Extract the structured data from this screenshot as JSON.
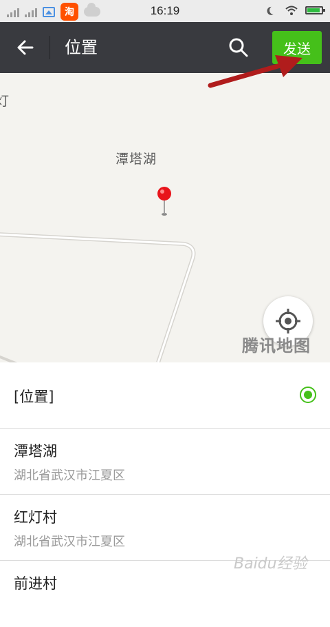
{
  "status_bar": {
    "time": "16:19"
  },
  "title_bar": {
    "title": "位置",
    "send_label": "发送"
  },
  "map": {
    "top_label": "灯",
    "place_label": "潭塔湖",
    "brand": "腾讯地图"
  },
  "list": {
    "current_label": "[位置]",
    "places": [
      {
        "name": "潭塔湖",
        "address": "湖北省武汉市江夏区"
      },
      {
        "name": "红灯村",
        "address": "湖北省武汉市江夏区"
      },
      {
        "name": "前进村",
        "address": ""
      }
    ]
  },
  "watermark": "Baidu经验",
  "colors": {
    "titlebar": "#393a3f",
    "accent": "#45c01a",
    "arrow": "#b01c1c"
  }
}
